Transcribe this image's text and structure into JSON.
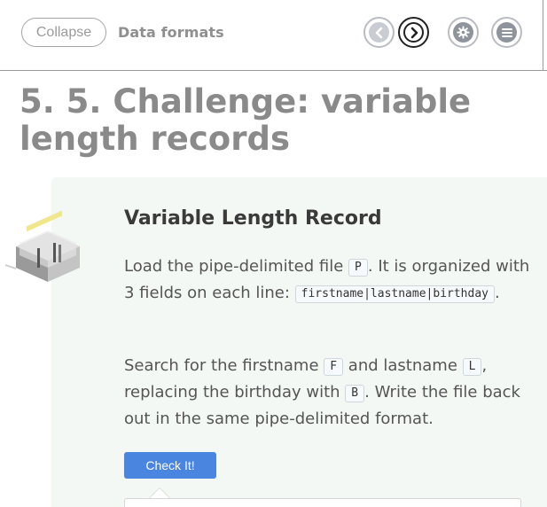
{
  "header": {
    "collapse_label": "Collapse",
    "section_title": "Data formats",
    "icons": [
      "chevron-left-icon",
      "chevron-right-icon",
      "gear-icon",
      "menu-icon"
    ]
  },
  "page": {
    "title": "5. 5. Challenge: variable length records"
  },
  "challenge": {
    "title": "Variable Length Record",
    "para1": {
      "t1": "Load the pipe-delimited file ",
      "code1": "P",
      "t2": ". It is organized with 3 fields on each line: ",
      "code2": "firstname|lastname|birthday",
      "t3": "."
    },
    "para2": {
      "t1": "Search for the firstname ",
      "code1": "F",
      "t2": " and lastname ",
      "code2": "L",
      "t3": ", replacing the birthday with ",
      "code3": "B",
      "t4": ". Write the file back out in the same pipe-delimited format."
    },
    "check_label": "Check It!"
  },
  "colors": {
    "accent": "#4a86e0",
    "card_bg": "#f3f8f5",
    "title_gray": "#8a8a8a"
  }
}
